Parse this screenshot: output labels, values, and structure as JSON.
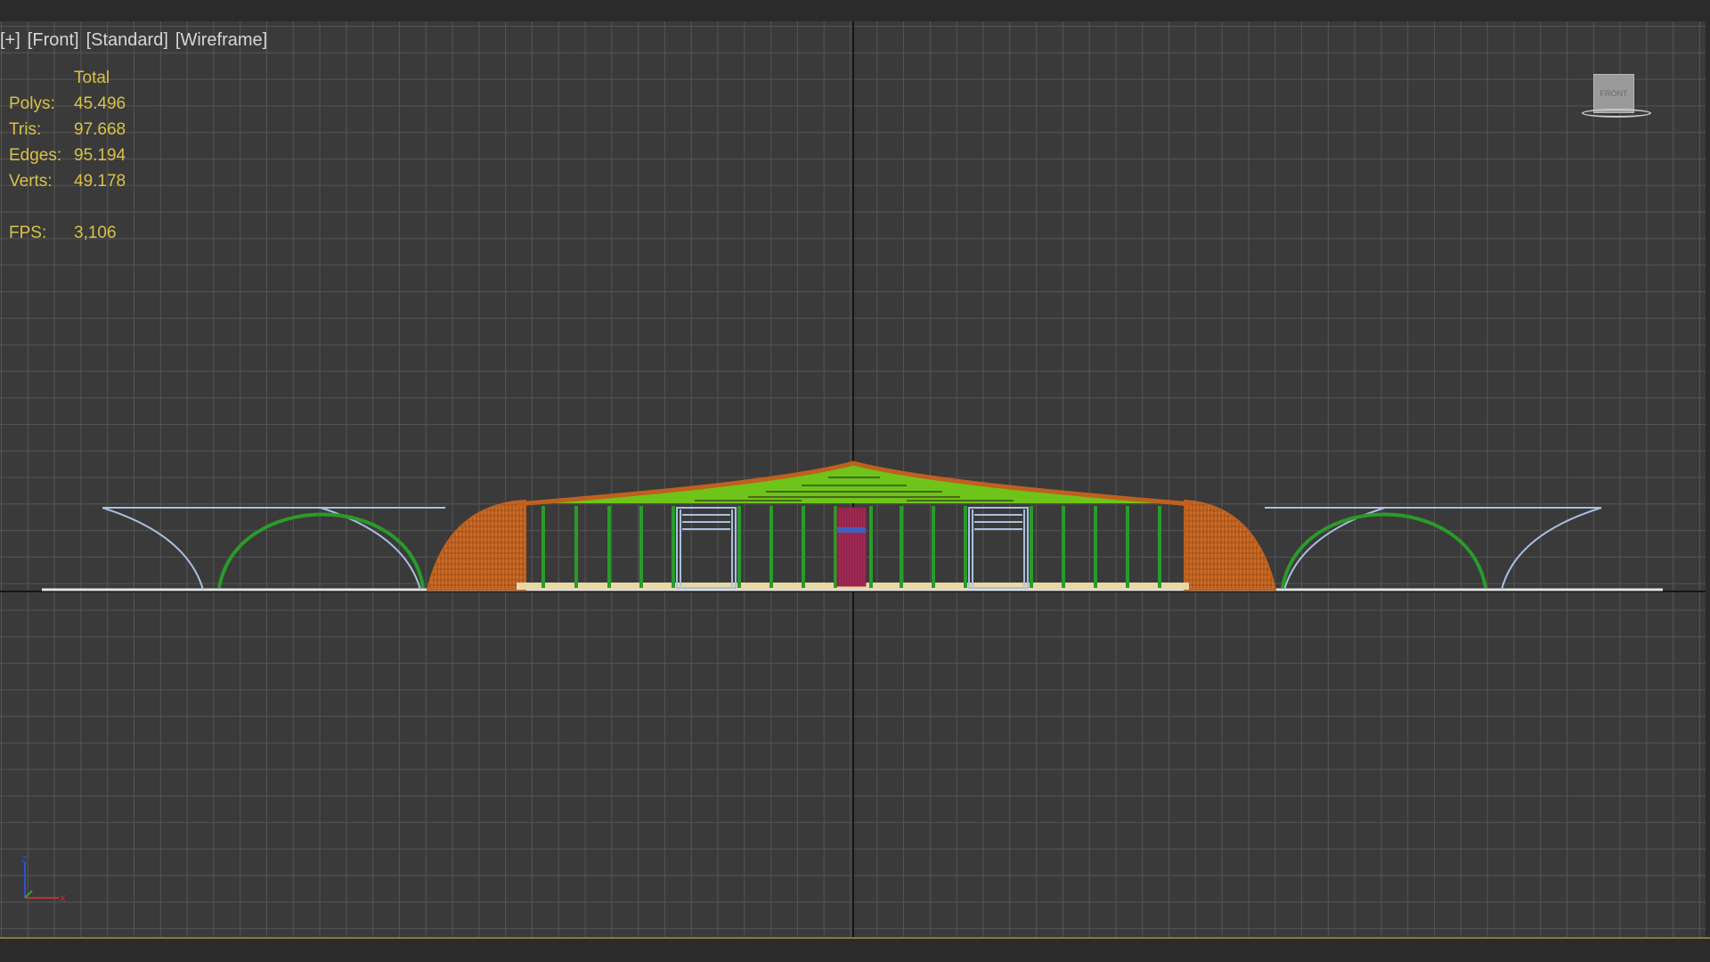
{
  "viewport": {
    "label_parts": [
      "[+]",
      "[Front]",
      "[Standard]",
      "[Wireframe]"
    ]
  },
  "stats": {
    "header": "Total",
    "polys_label": "Polys:",
    "polys": "45.496",
    "tris_label": "Tris:",
    "tris": "97.668",
    "edges_label": "Edges:",
    "edges": "95.194",
    "verts_label": "Verts:",
    "verts": "49.178",
    "fps_label": "FPS:",
    "fps": "3,106"
  },
  "viewcube": {
    "face_label": "FRONT"
  },
  "axis_tripod": {
    "z": "Z",
    "x": "X"
  },
  "colors": {
    "grid_bg": "#3a3a3a",
    "grid_line": "#555555",
    "stats_text": "#d8c24a",
    "roof_orange": "#c0601e",
    "roof_green": "#6fc41a",
    "column_green": "#2a9a2a",
    "frame_blue": "#a8c0e0",
    "door_red": "#a02050",
    "floor_cream": "#e8d8a8",
    "ground_white": "#e0e0e0"
  }
}
